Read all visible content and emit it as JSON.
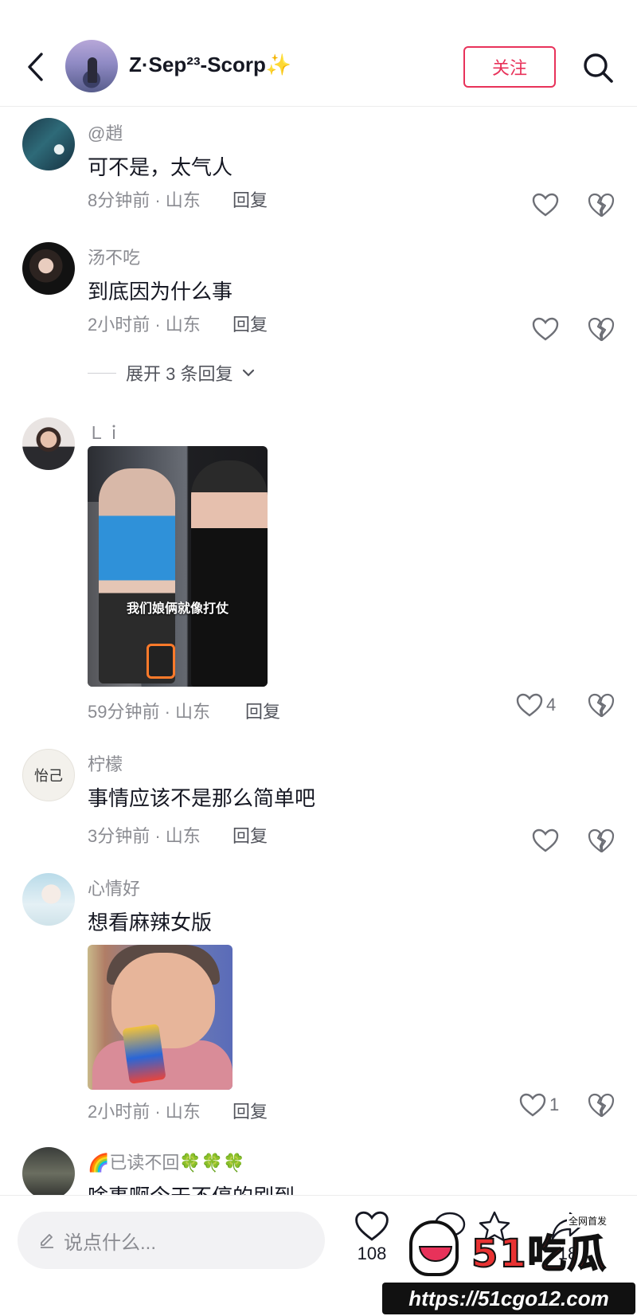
{
  "header": {
    "title": "Z·Sep²³-Scorp✨",
    "follow_label": "关注"
  },
  "comments": [
    {
      "name": "@趙",
      "text": "可不是，太气人",
      "meta": "8分钟前 · 山东",
      "reply": "回复",
      "likes": ""
    },
    {
      "name": "汤不吃",
      "text": "到底因为什么事",
      "meta": "2小时前 · 山东",
      "reply": "回复",
      "likes": "",
      "expand": "展开 3 条回复"
    },
    {
      "name": "Ｌｉ",
      "text": "",
      "image_caption": "我们娘俩就像打仗",
      "meta": "59分钟前 · 山东",
      "reply": "回复",
      "likes": "4"
    },
    {
      "name": "柠檬",
      "text": "事情应该不是那么简单吧",
      "meta": "3分钟前 · 山东",
      "reply": "回复",
      "likes": ""
    },
    {
      "name": "心情好",
      "text": "想看麻辣女版",
      "meta": "2小时前 · 山东",
      "reply": "回复",
      "likes": "1"
    },
    {
      "name": "🌈已读不回🍀🍀🍀",
      "text": "啥事啊今天不停的刷到"
    }
  ],
  "avatar5_text": "怡己",
  "bottom": {
    "input_placeholder": "说点什么...",
    "like_count": "108",
    "share_count": "18"
  },
  "watermark": {
    "brand": "51吃瓜",
    "tag": "全网首发",
    "url": "https://51cgo12.com"
  },
  "colors": {
    "accent": "#e8325a",
    "meta_gray": "#8a8b91",
    "text": "#161823"
  }
}
